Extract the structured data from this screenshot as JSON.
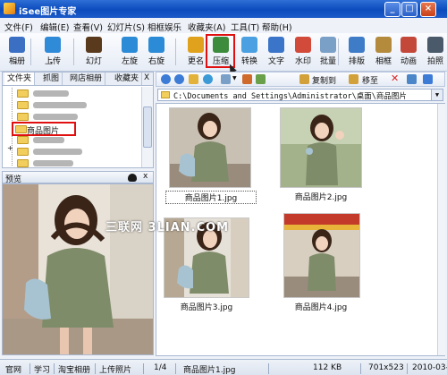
{
  "window": {
    "title": "iSee图片专家"
  },
  "menu": [
    "文件(F)",
    "编辑(E)",
    "查看(V)",
    "幻灯片(S)",
    "相框娱乐",
    "收藏夹(A)",
    "工具(T)",
    "帮助(H)"
  ],
  "toolbar": [
    {
      "label": "相册",
      "icon": "album-icon",
      "color": "#3a6fc4"
    },
    {
      "label": "上传",
      "icon": "upload-icon",
      "color": "#2f8ad8"
    },
    {
      "label": "幻灯",
      "icon": "slideshow-icon",
      "color": "#5a3a1c"
    },
    {
      "label": "左旋",
      "icon": "rotate-left-icon",
      "color": "#2c8bd6"
    },
    {
      "label": "右旋",
      "icon": "rotate-right-icon",
      "color": "#2c8bd6"
    },
    {
      "label": "更名",
      "icon": "rename-icon",
      "color": "#e0a21d"
    },
    {
      "label": "压缩",
      "icon": "compress-icon",
      "color": "#3d8c3d"
    },
    {
      "label": "转换",
      "icon": "convert-icon",
      "color": "#4aa0e0"
    },
    {
      "label": "文字",
      "icon": "text-icon",
      "color": "#3b75c9"
    },
    {
      "label": "水印",
      "icon": "watermark-icon",
      "color": "#d24a3a"
    },
    {
      "label": "批量",
      "icon": "batch-icon",
      "color": "#7aa0c8"
    },
    {
      "label": "排版",
      "icon": "layout-icon",
      "color": "#3f7cc8"
    },
    {
      "label": "相框",
      "icon": "frame-icon",
      "color": "#b48a3c"
    },
    {
      "label": "动画",
      "icon": "animation-icon",
      "color": "#c4483a"
    },
    {
      "label": "拍照",
      "icon": "camera-icon",
      "color": "#4a5a6a"
    }
  ],
  "left_tabs": [
    "文件夹",
    "抓图",
    "网店相册",
    "收藏夹"
  ],
  "left_tabs_close": "X",
  "tree": {
    "selected": "商品图片"
  },
  "preview": {
    "title": "预览",
    "close": "x"
  },
  "nav": {
    "copy_to": "复制到",
    "move_to": "移至"
  },
  "address": {
    "path": "C:\\Documents and Settings\\Administrator\\桌面\\商品图片"
  },
  "thumbnails": [
    {
      "name": "商品图片1.jpg",
      "selected": true
    },
    {
      "name": "商品图片2.jpg",
      "selected": false
    },
    {
      "name": "商品图片3.jpg",
      "selected": false
    },
    {
      "name": "商品图片4.jpg",
      "selected": false
    }
  ],
  "watermark": "三联网 3LIAN.COM",
  "status": {
    "items": [
      "官网",
      "学习",
      "淘宝相册",
      "上传照片"
    ],
    "position": "1/4",
    "filename": "商品图片1.jpg",
    "size": "112 KB",
    "dims": "701x523",
    "date": "2010-03-"
  },
  "colors": {
    "highlight": "#e01010",
    "titlebar": "#0b4bbd"
  }
}
